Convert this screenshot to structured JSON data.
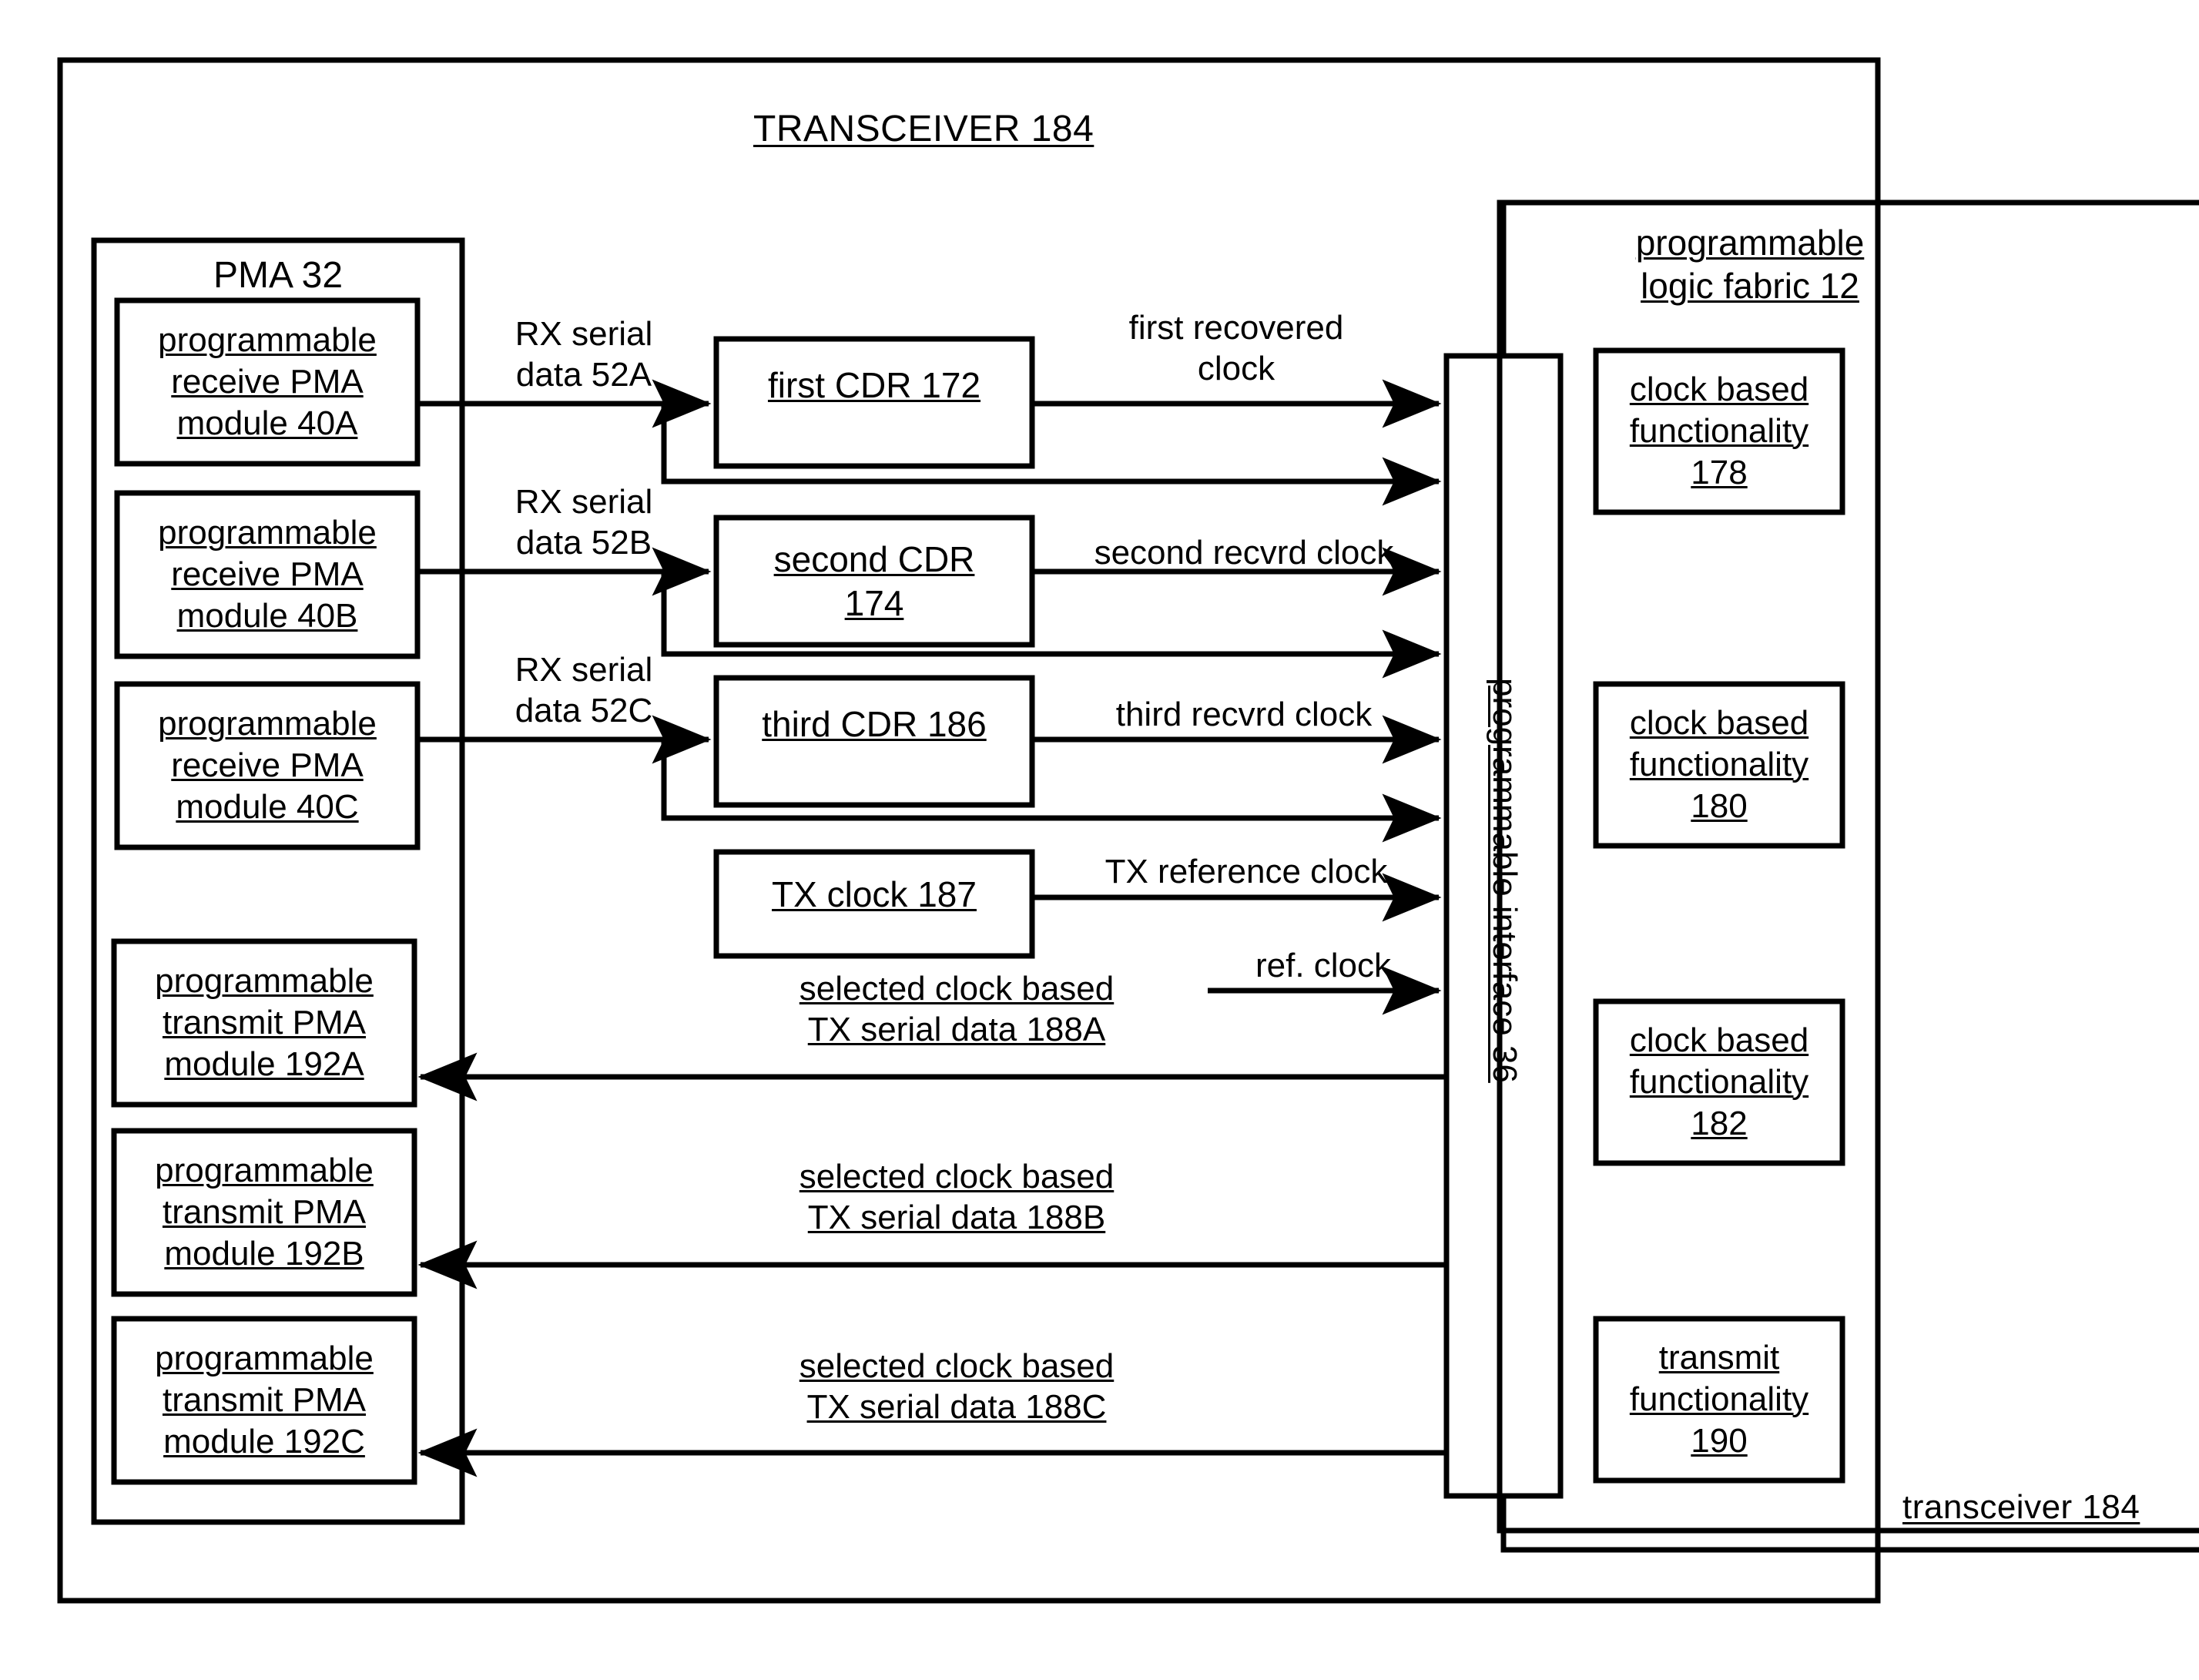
{
  "figure": {
    "title": "TRANSCEIVER 184",
    "outer_label": "transceiver 184"
  },
  "pma": {
    "title": "PMA 32",
    "receive_modules": [
      {
        "line1": "programmable",
        "line2": "receive PMA",
        "line3": "module 40A"
      },
      {
        "line1": "programmable",
        "line2": "receive PMA",
        "line3": "module 40B"
      },
      {
        "line1": "programmable",
        "line2": "receive PMA",
        "line3": "module 40C"
      }
    ],
    "transmit_modules": [
      {
        "line1": "programmable",
        "line2": "transmit PMA",
        "line3": "module 192A"
      },
      {
        "line1": "programmable",
        "line2": "transmit PMA",
        "line3": "module 192B"
      },
      {
        "line1": "programmable",
        "line2": "transmit PMA",
        "line3": "module 192C"
      }
    ]
  },
  "cdrs": [
    {
      "line1": "first CDR 172",
      "line2": ""
    },
    {
      "line1": "second CDR",
      "line2": "174"
    },
    {
      "line1": "third CDR 186",
      "line2": ""
    }
  ],
  "tx_clock": {
    "label": "TX clock 187"
  },
  "interface": {
    "label": "programmable interface 36"
  },
  "fabric": {
    "line1": "programmable",
    "line2": "logic fabric 12",
    "blocks": [
      {
        "line1": "clock based",
        "line2": "functionality",
        "line3": "178"
      },
      {
        "line1": "clock based",
        "line2": "functionality",
        "line3": "180"
      },
      {
        "line1": "clock based",
        "line2": "functionality",
        "line3": "182"
      },
      {
        "line1": "transmit",
        "line2": "functionality",
        "line3": "190"
      }
    ]
  },
  "signals": {
    "rx_serial_a": {
      "line1": "RX serial",
      "line2": "data 52A"
    },
    "rx_serial_b": {
      "line1": "RX serial",
      "line2": "data 52B"
    },
    "rx_serial_c": {
      "line1": "RX serial",
      "line2": "data 52C"
    },
    "first_recovered_clock": {
      "line1": "first recovered",
      "line2": "clock"
    },
    "second_recvrd_clock": {
      "line1": "second recvrd clock"
    },
    "third_recvrd_clock": {
      "line1": "third recvrd clock"
    },
    "tx_reference_clock": {
      "line1": "TX reference clock"
    },
    "ref_clock": {
      "line1": "ref. clock"
    },
    "tx_serial_a": {
      "line1": "selected clock based",
      "line2": "TX serial data 188A"
    },
    "tx_serial_b": {
      "line1": "selected clock based",
      "line2": "TX serial data 188B"
    },
    "tx_serial_c": {
      "line1": "selected clock based",
      "line2": "TX serial data 188C"
    }
  },
  "style": {
    "ink": "#000000",
    "paper": "#ffffff"
  }
}
